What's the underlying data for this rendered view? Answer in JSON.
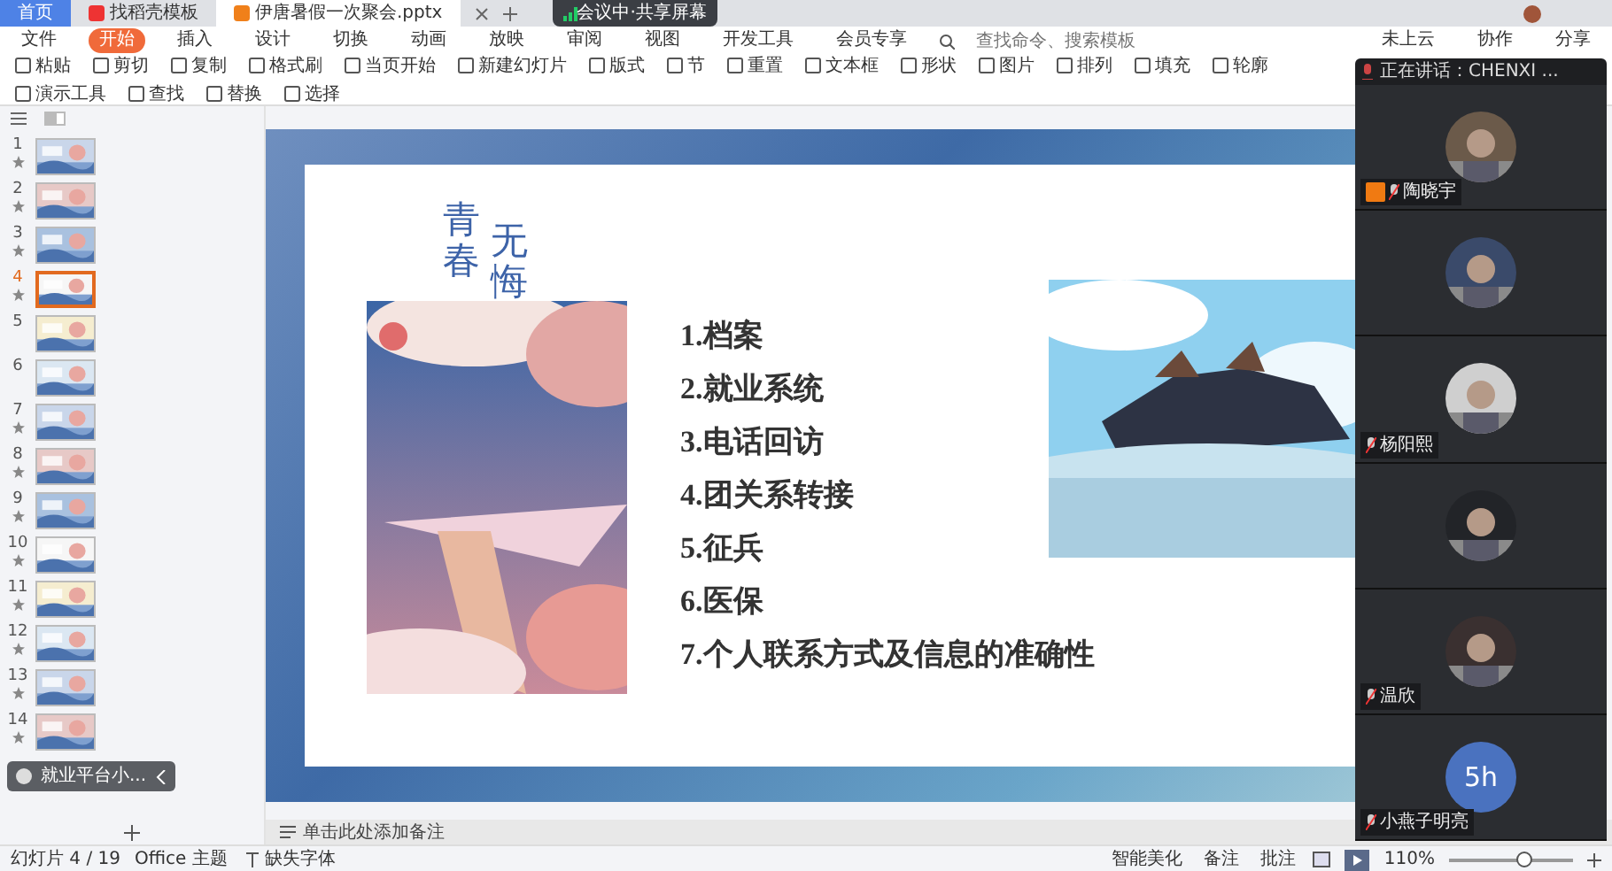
{
  "window_tabs": [
    {
      "label": "首页",
      "selected": false,
      "kind": "home"
    },
    {
      "label": "找稻壳模板",
      "selected": false,
      "kind": "docer"
    },
    {
      "label": "伊唐暑假一次聚会.pptx",
      "selected": true,
      "kind": "doc"
    }
  ],
  "share_banner": "会议中·共享屏幕",
  "menu": {
    "file": "文件",
    "items": [
      {
        "label": "开始",
        "selected": true
      },
      {
        "label": "插入",
        "selected": false
      },
      {
        "label": "设计",
        "selected": false
      },
      {
        "label": "切换",
        "selected": false
      },
      {
        "label": "动画",
        "selected": false
      },
      {
        "label": "放映",
        "selected": false
      },
      {
        "label": "审阅",
        "selected": false
      },
      {
        "label": "视图",
        "selected": false
      },
      {
        "label": "开发工具",
        "selected": false
      },
      {
        "label": "会员专享",
        "selected": false
      }
    ],
    "search": {
      "placeholder": "查找命令、搜索模板"
    },
    "actions": [
      "未上云",
      "协作",
      "分享"
    ]
  },
  "ribbon": [
    "粘贴",
    "剪切",
    "复制",
    "格式刷",
    "当页开始",
    "新建幻灯片",
    "版式",
    "节",
    "重置",
    "文本框",
    "形状",
    "图片",
    "排列",
    "填充",
    "轮廓",
    "演示工具",
    "查找",
    "替换",
    "选择"
  ],
  "slides": [
    {
      "number": "1",
      "selected": false,
      "animated": true
    },
    {
      "number": "2",
      "selected": false,
      "animated": true
    },
    {
      "number": "3",
      "selected": false,
      "animated": true
    },
    {
      "number": "4",
      "selected": true,
      "animated": true
    },
    {
      "number": "5",
      "selected": false,
      "animated": false
    },
    {
      "number": "6",
      "selected": false,
      "animated": false
    },
    {
      "number": "7",
      "selected": false,
      "animated": true
    },
    {
      "number": "8",
      "selected": false,
      "animated": true
    },
    {
      "number": "9",
      "selected": false,
      "animated": true
    },
    {
      "number": "10",
      "selected": false,
      "animated": true
    },
    {
      "number": "11",
      "selected": false,
      "animated": true
    },
    {
      "number": "12",
      "selected": false,
      "animated": true
    },
    {
      "number": "13",
      "selected": false,
      "animated": true
    },
    {
      "number": "14",
      "selected": false,
      "animated": true
    }
  ],
  "floating_bar": "就业平台小...",
  "slide": {
    "title_columns": [
      "青春",
      "无悔"
    ],
    "items": [
      "1.档案",
      "2.就业系统",
      "3.电话回访",
      "4.团关系转接",
      "5.征兵",
      "6.医保",
      "7.个人联系方式及信息的准确性"
    ]
  },
  "notes": {
    "placeholder": "单击此处添加备注"
  },
  "status": {
    "slide_count": "幻灯片 4 / 19",
    "theme": "Office 主题",
    "missing_fonts": "缺失字体",
    "beautify": "智能美化",
    "notes": "备注",
    "comments": "批注",
    "zoom": "110%",
    "zoom_slider": {
      "level": 0.6
    }
  },
  "meeting": {
    "speaking": "正在讲话：CHENXI ...",
    "participants": [
      {
        "name": "陶晓宇",
        "host": true,
        "kind": "picture"
      },
      {
        "host": false,
        "kind": "picture"
      },
      {
        "name": "杨阳熙",
        "host": false,
        "kind": "picture"
      },
      {
        "host": false,
        "kind": "picture"
      },
      {
        "name": "温欣",
        "host": false,
        "kind": "picture"
      },
      {
        "name": "小燕子明亮",
        "host": false,
        "kind": "initials",
        "initials": "5h"
      }
    ]
  }
}
